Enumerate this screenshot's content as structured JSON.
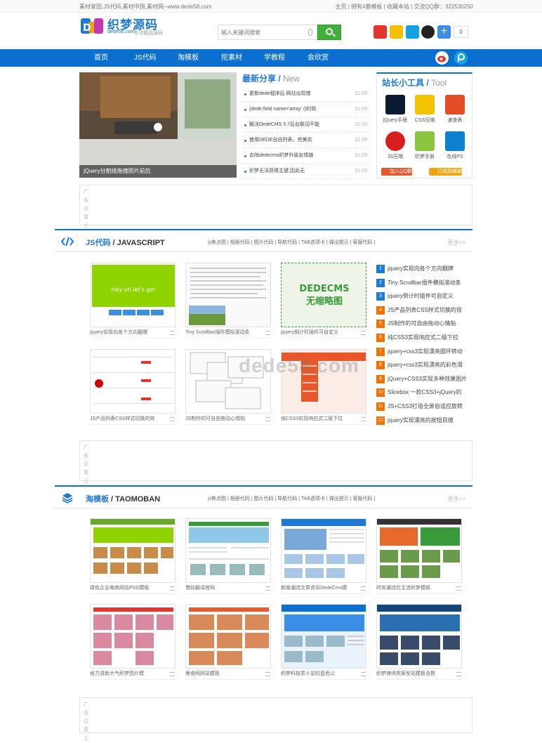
{
  "topbar": {
    "left": "素材家园,JS代码,素材中国,素材网--www.dede58.com",
    "right": "主页 | 拥有4套模板 | 收藏本站 | 交流QQ群：322530250"
  },
  "logo": {
    "name": "织梦源码",
    "domain": "dede58.com",
    "slogan": "专注精品源码"
  },
  "search": {
    "placeholder": "输入关键词搜索"
  },
  "social": {
    "count": "0"
  },
  "nav": [
    "首页",
    "JS代码",
    "淘模板",
    "挖素材",
    "学教程",
    "会欣赏"
  ],
  "slider": {
    "caption": "jQuery分割线拖拽照片前后"
  },
  "news": {
    "title": "最新分享",
    "title_en": "New",
    "items": [
      {
        "text": "更新dede程序后 网站出现错",
        "date": "11-29"
      },
      {
        "text": "{dede:field name='array' /}的简",
        "date": "11-29"
      },
      {
        "text": "解决DedeCMS 5.7后台联动不能",
        "date": "11-29"
      },
      {
        "text": "使用DEDE自由列表，完美实",
        "date": "11-29"
      },
      {
        "text": "去除dedecms织梦升级友情链",
        "date": "11-29"
      },
      {
        "text": "织梦无法获得主键,因此无",
        "date": "11-29"
      }
    ]
  },
  "tools": {
    "title": "站长小工具",
    "title_en": "Tool",
    "items": [
      "jQuery手册",
      "CSS压缩",
      "速查表",
      "JS压缩",
      "织梦手册",
      "在线PS"
    ],
    "qq": "加入QQ群",
    "mail": "订阅到邮箱"
  },
  "ad": {
    "text": "广告位置上"
  },
  "js_section": {
    "icon": "</>",
    "title": "JS代码",
    "title_en": "JAVASCRIPT",
    "tags": "js焦点图 | 相册代码 | 图片代码 | 导航代码 | TAB选项卡 | 弹出提示 | 客服代码 |",
    "more": "更多>>",
    "cards": [
      "jquery实现向各个方向翻牌",
      "Tiny Scrollbar插件模拟滚动条",
      "jquery倒计时插件可自定义",
      "JS产品列表CSS样式切换的效",
      "JS制作的可自由拖动心情贴",
      "纯CSS3实现响应式二级下拉"
    ],
    "ranking": [
      "jquery实现向各个方向翻牌",
      "Tiny Scrollbar插件模拟滚动条",
      "jquery倒计时插件可自定义",
      "JS产品列表CSS样式切换的效",
      "JS制作的可自由拖动心情贴",
      "纯CSS3实现响应式二级下拉",
      "jquery+css3实现漂亮圆环转动",
      "jquery+css3实现漂亮的彩色滑",
      "jQuery+CSS3实现多种效果图片",
      "Slicebox 一款CSS3+jQuery的",
      "JS+CSS3打造全屏自适应旋转",
      "jquery实现漂亮的按钮目搜"
    ]
  },
  "placeholder": {
    "line1": "DEDECMS",
    "line2": "无缩略图"
  },
  "demo": {
    "hello": "Hey oh let's go!"
  },
  "watermark": "dede58.com",
  "tao_section": {
    "title": "淘模板",
    "title_en": "TAOMOBAN",
    "tags": "js焦点图 | 相册代码 | 图片代码 | 导航代码 | TAB选项卡 | 弹出提示 | 客服代码 |",
    "more": "更多>>",
    "cards": [
      "绿色企业电商网站PSD模板",
      "慧跃翻译官网",
      "新版潮流文章资讯DedeCms模",
      "时尚潮流社主流织梦模板",
      "格力清新大气织梦图片模",
      "美食网网站模板",
      "织梦科技质十足的蓝色公",
      "织梦律师类案型站模板含数"
    ]
  },
  "colors": {
    "primary": "#0b6fd0",
    "green": "#3fb039",
    "rank_blue": "#1e78d6",
    "rank_orange": "#f27200"
  }
}
